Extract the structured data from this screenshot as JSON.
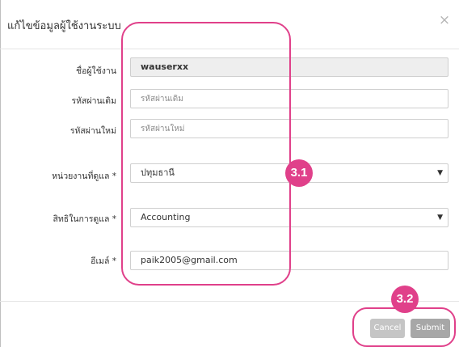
{
  "dialog": {
    "title": "แก้ไขข้อมูลผู้ใช้งานระบบ",
    "close_glyph": "×"
  },
  "form": {
    "username": {
      "label": "ชื่อผู้ใช้งาน",
      "value": "wauserxx"
    },
    "old_password": {
      "label": "รหัสผ่านเดิม",
      "placeholder": "รหัสผ่านเดิม"
    },
    "new_password": {
      "label": "รหัสผ่านใหม่",
      "placeholder": "รหัสผ่านใหม่"
    },
    "unit": {
      "label": "หน่วยงานที่ดูแล *",
      "value": "ปทุมธานี"
    },
    "permission": {
      "label": "สิทธิในการดูแล *",
      "value": "Accounting"
    },
    "email": {
      "label": "อีเมล์ *",
      "value": "paik2005@gmail.com"
    }
  },
  "footer": {
    "cancel_label": "Cancel",
    "submit_label": "Submit"
  },
  "annotations": {
    "badge_1": "3.1",
    "badge_2": "3.2",
    "accent_color": "#e0408a"
  },
  "icons": {
    "dropdown": "caret-down-icon",
    "close": "close-icon"
  }
}
